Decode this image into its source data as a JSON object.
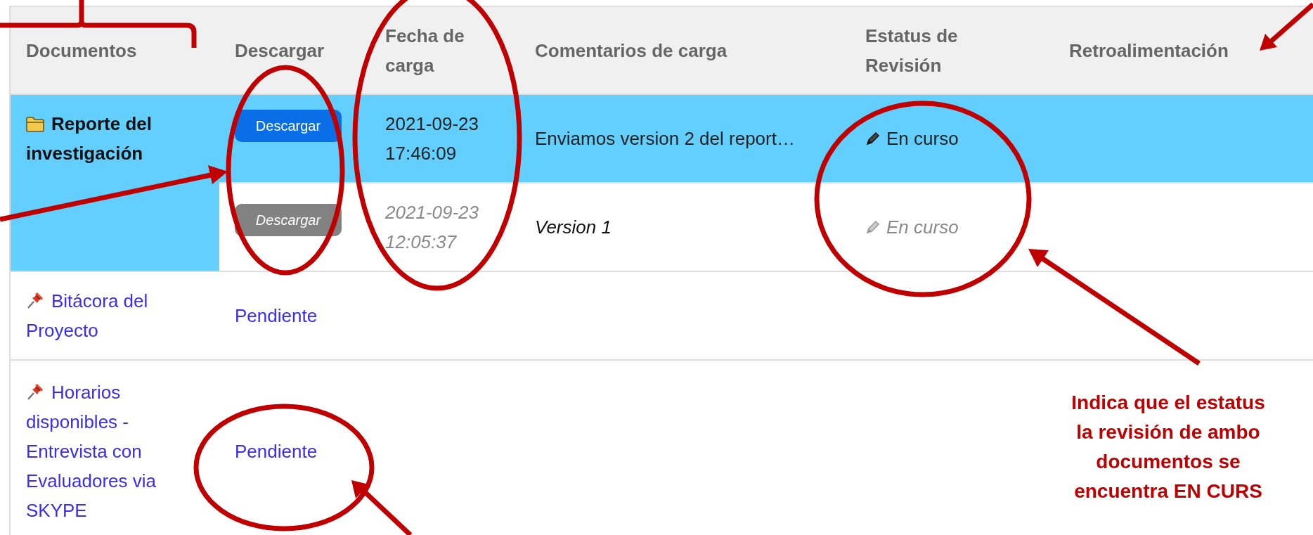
{
  "table": {
    "columns": [
      "Documentos",
      "Descargar",
      "Fecha de carga",
      "Comentarios de carga",
      "Estatus de Revisión",
      "Retroalimentación"
    ],
    "rows": [
      {
        "kind": "group",
        "document": "Reporte del investigación",
        "selected": true,
        "versions": [
          {
            "button": "Descargar",
            "uploaded": "2021-09-23 17:46:09",
            "comment": "Enviamos version 2 del report…",
            "status": "En curso",
            "current": true
          },
          {
            "button": "Descargar",
            "uploaded": "2021-09-23 12:05:37",
            "comment": "Version 1",
            "status": "En curso",
            "current": false
          }
        ]
      },
      {
        "kind": "pending",
        "document": "Bitácora del Proyecto",
        "download": "Pendiente"
      },
      {
        "kind": "pending",
        "document": "Horarios disponibles - Entrevista con Evaluadores via SKYPE",
        "download": "Pendiente"
      }
    ]
  },
  "annotation": {
    "lines": [
      "Indica que el estatus",
      "la revisión de ambo",
      "documentos se",
      "encuentra EN CURS"
    ]
  }
}
